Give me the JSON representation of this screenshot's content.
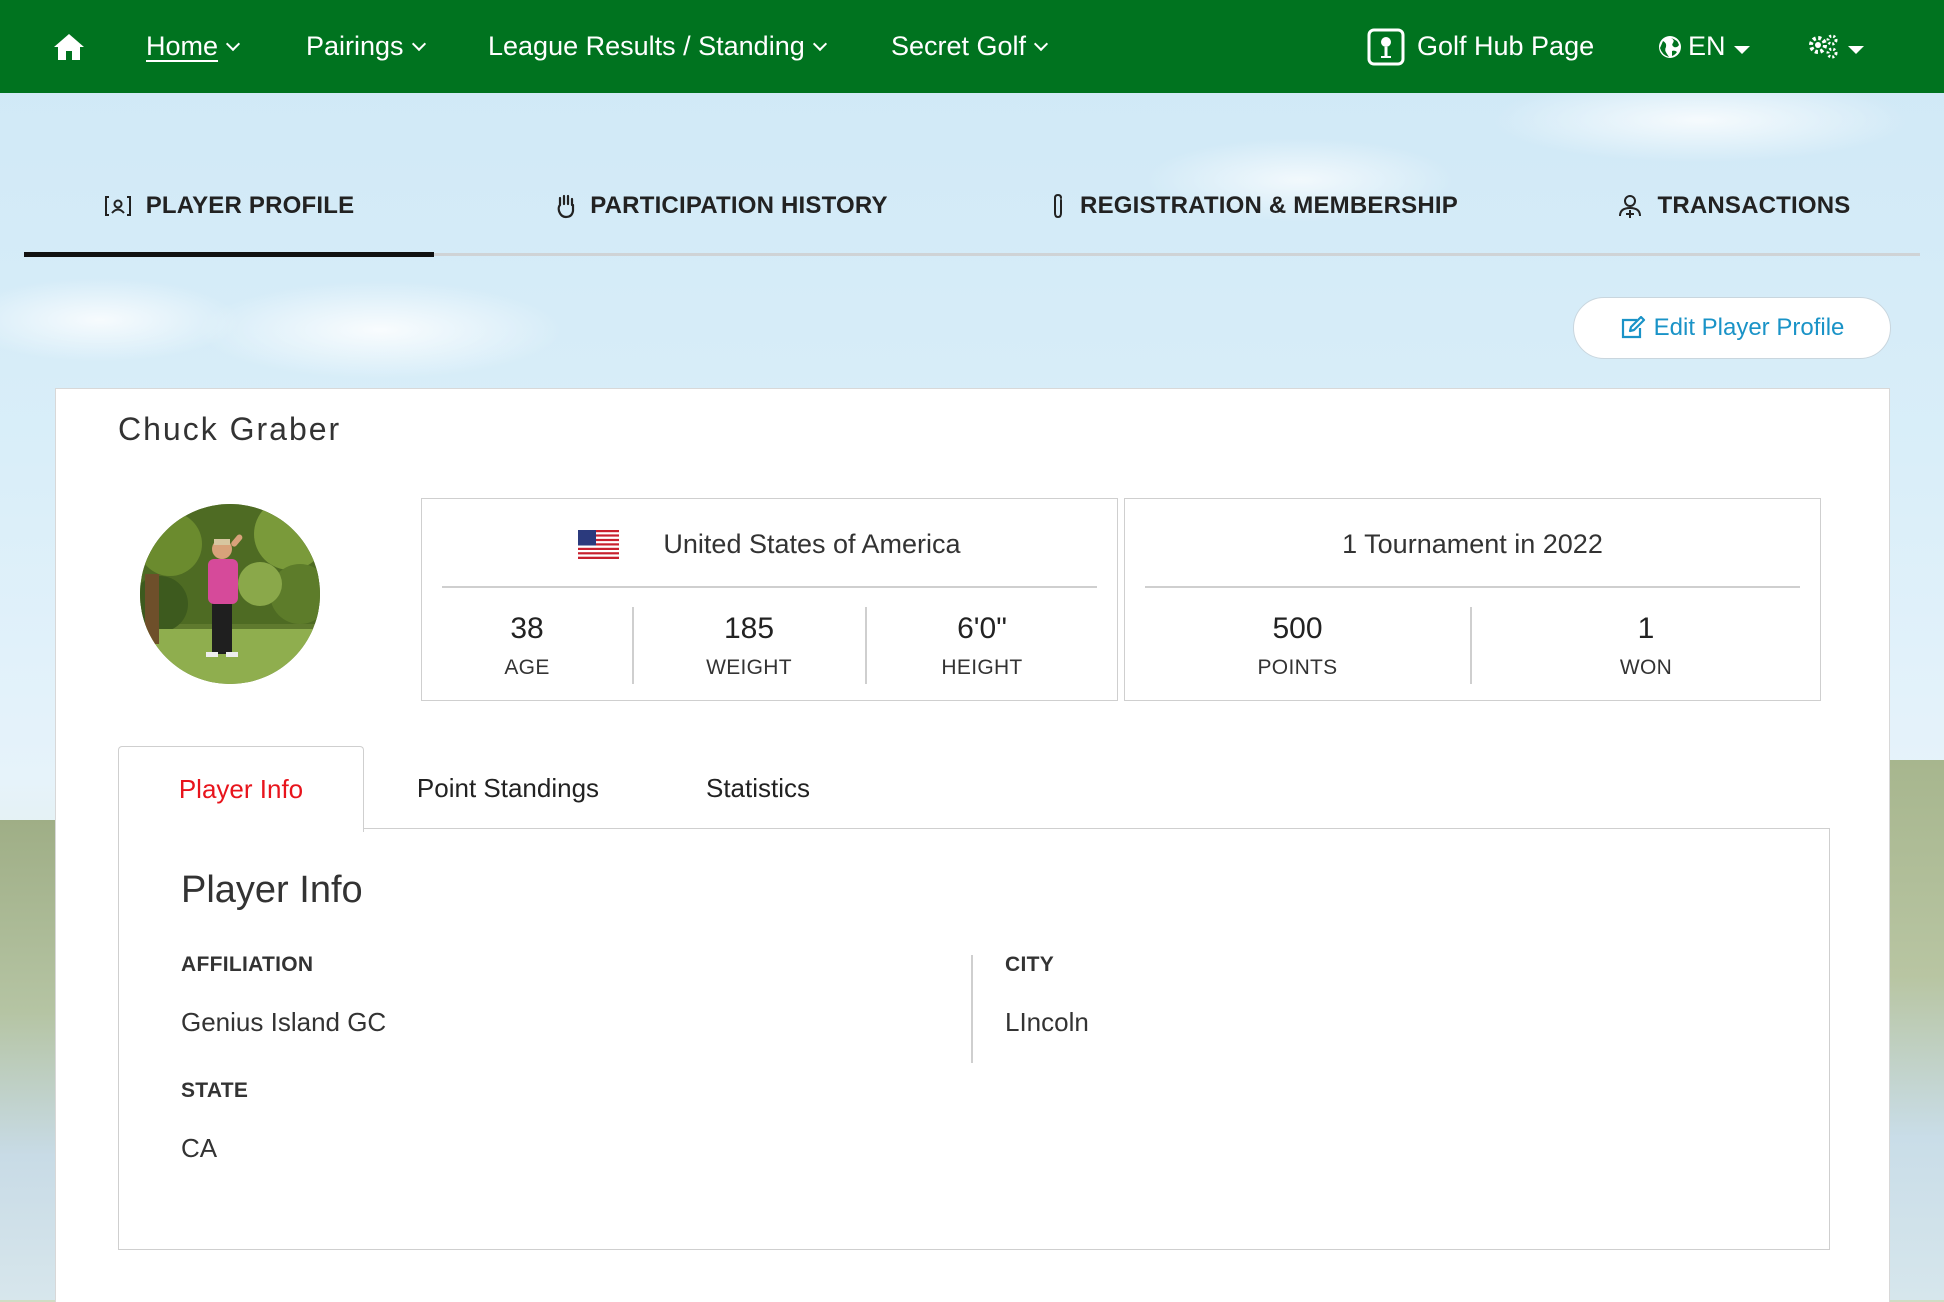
{
  "nav": {
    "home_label": "Home",
    "pairings_label": "Pairings",
    "league_label": "League Results / Standing",
    "secret_golf_label": "Secret Golf",
    "golf_hub_label": "Golf Hub Page",
    "language_label": "EN"
  },
  "profile_tabs": {
    "player_profile": "PLAYER PROFILE",
    "participation_history": "PARTICIPATION HISTORY",
    "registration_membership": "REGISTRATION & MEMBERSHIP",
    "transactions": "TRANSACTIONS"
  },
  "edit_button_label": "Edit Player Profile",
  "player": {
    "name": "Chuck Graber",
    "country": "United States of America",
    "age": "38",
    "age_label": "AGE",
    "weight": "185",
    "weight_label": "WEIGHT",
    "height": "6'0\"",
    "height_label": "HEIGHT",
    "tournaments": "1 Tournament in 2022",
    "points": "500",
    "points_label": "POINTS",
    "won": "1",
    "won_label": "WON"
  },
  "info_tabs": {
    "player_info": "Player Info",
    "point_standings": "Point Standings",
    "statistics": "Statistics"
  },
  "player_info": {
    "title": "Player Info",
    "affiliation_label": "AFFILIATION",
    "affiliation_value": "Genius Island GC",
    "city_label": "CITY",
    "city_value": "LIncoln",
    "state_label": "STATE",
    "state_value": "CA"
  },
  "colors": {
    "nav_green": "#00731f",
    "link_blue": "#1a93c7",
    "active_tab_red": "#e8141c"
  }
}
